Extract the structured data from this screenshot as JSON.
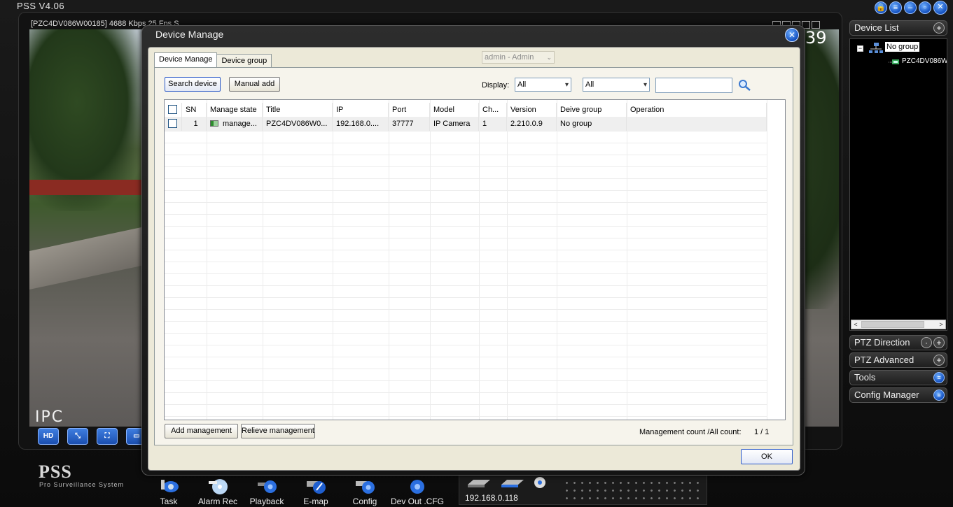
{
  "app": {
    "title": "PSS  V4.06"
  },
  "video": {
    "channel_label": "[PZC4DV086W00185]  4688 Kbps 25 Fps S",
    "overlay_text": "IPC",
    "clock_fragment": "39",
    "buttons": [
      "HD",
      "",
      "",
      ""
    ]
  },
  "right_panel": {
    "device_list": "Device List",
    "tree": {
      "group": "No group",
      "device": "PZC4DV086W"
    },
    "sections": [
      "PTZ Direction",
      "PTZ Advanced",
      "Tools",
      "Config Manager"
    ]
  },
  "logo": {
    "name": "PSS",
    "tagline": "Pro Surveillance System"
  },
  "taskbar": [
    "Task",
    "Alarm Rec",
    "Playback",
    "E-map",
    "Config",
    "Dev Out .CFG"
  ],
  "status": {
    "ip": "192.168.0.118"
  },
  "dialog": {
    "title": "Device Manage",
    "tabs": [
      "Device Manage",
      "Device group"
    ],
    "user": "admin - Admin",
    "search_button": "Search device",
    "manual_add_button": "Manual add",
    "display_label": "Display:",
    "filter1": "All",
    "filter2": "All",
    "search_value": "",
    "columns": [
      "SN",
      "Manage state",
      "Title",
      "IP",
      "Port",
      "Model",
      "Ch...",
      "Version",
      "Deive group",
      "Operation"
    ],
    "rows": [
      {
        "sn": "1",
        "state": "manage...",
        "title": "PZC4DV086W0...",
        "ip": "192.168.0....",
        "port": "37777",
        "model": "IP Camera",
        "ch": "1",
        "version": "2.210.0.9",
        "group": "No group",
        "operation": ""
      }
    ],
    "add_management": "Add management",
    "relieve_management": "Relieve management",
    "count_label": "Management count /All count:",
    "count_value": "1 / 1",
    "ok": "OK"
  },
  "colors": {
    "accent": "#1350c0",
    "dialog_bg": "#ece9d8"
  }
}
